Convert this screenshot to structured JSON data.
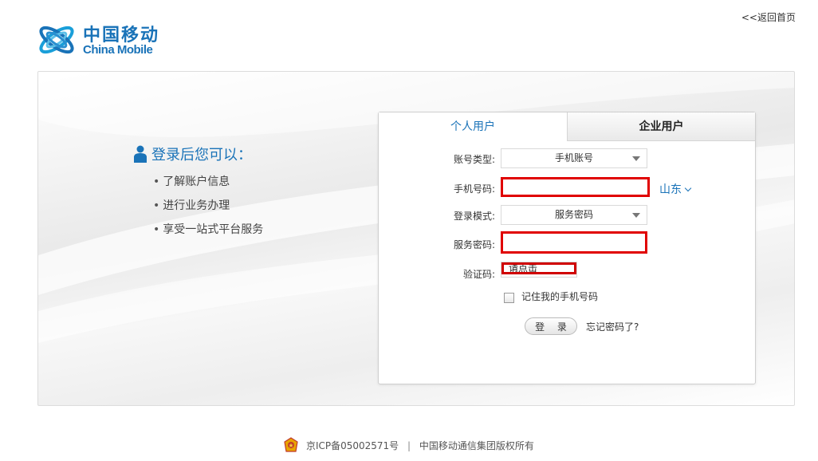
{
  "header": {
    "logo_cn": "中国移动",
    "logo_en": "China Mobile",
    "back_home": "<<返回首页"
  },
  "info": {
    "title": "登录后您可以：",
    "items": [
      "了解账户信息",
      "进行业务办理",
      "享受一站式平台服务"
    ]
  },
  "login": {
    "tabs": [
      {
        "label": "个人用户",
        "active": true
      },
      {
        "label": "企业用户",
        "active": false
      }
    ],
    "account_type": {
      "label": "账号类型:",
      "value": "手机账号"
    },
    "phone": {
      "label": "手机号码:",
      "value": "",
      "region": "山东"
    },
    "login_mode": {
      "label": "登录模式:",
      "value": "服务密码"
    },
    "service_password": {
      "label": "服务密码:",
      "value": ""
    },
    "captcha": {
      "label": "验证码:",
      "text": "请点击"
    },
    "remember_label": "记住我的手机号码",
    "login_button": "登 录",
    "forgot_link": "忘记密码了?"
  },
  "footer": {
    "icp": "京ICP备05002571号",
    "separator": "|",
    "copyright": "中国移动通信集团版权所有"
  },
  "colors": {
    "brand_blue": "#1a73b8",
    "highlight_red": "#e00000"
  }
}
